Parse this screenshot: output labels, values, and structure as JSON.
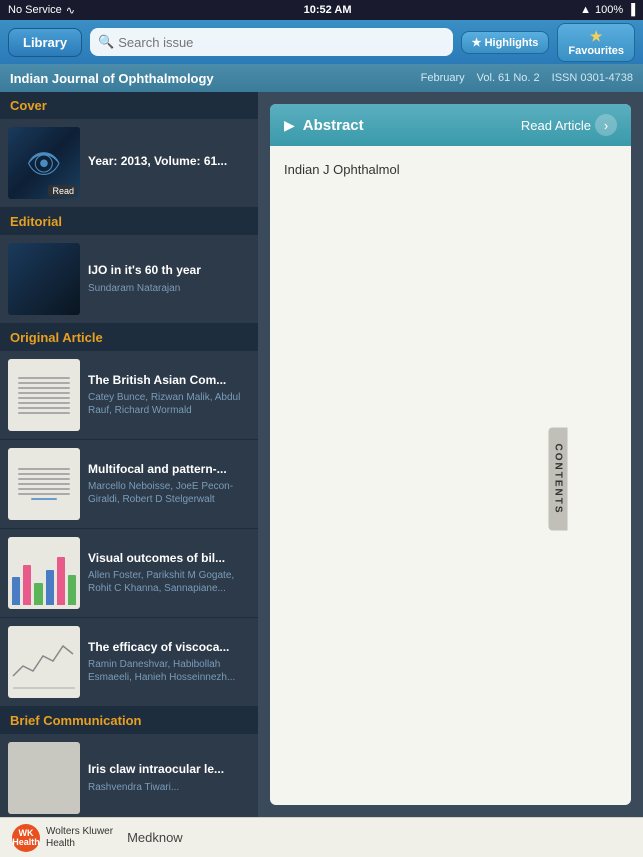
{
  "status_bar": {
    "carrier": "No Service",
    "time": "10:52 AM",
    "battery": "100%",
    "wifi": true,
    "location": true
  },
  "nav": {
    "library_label": "Library",
    "search_placeholder": "Search issue",
    "highlights_label": "Highlights",
    "favourites_label": "Favourites"
  },
  "journal_header": {
    "title": "Indian Journal of Ophthalmology",
    "month": "February",
    "volume": "Vol. 61 No. 2",
    "issn": "ISSN 0301-4738"
  },
  "sections": [
    {
      "name": "Cover",
      "articles": [
        {
          "title": "Year: 2013, Volume: 61...",
          "authors": "",
          "thumb_type": "cover",
          "has_read": true
        }
      ]
    },
    {
      "name": "Editorial",
      "articles": [
        {
          "title": "IJO in it's 60 th  year",
          "authors": "Sundaram Natarajan",
          "thumb_type": "editorial"
        }
      ]
    },
    {
      "name": "Original Article",
      "articles": [
        {
          "title": "The British Asian Com...",
          "authors": "Catey Bunce, Rizwan Malik, Abdul Rauf, Richard Wormald",
          "thumb_type": "document"
        },
        {
          "title": "Multifocal and pattern-...",
          "authors": "Marcello Neboisse, JoeE Pecon-Giraldi, Robert D Stelgerwalt",
          "thumb_type": "document2"
        },
        {
          "title": "Visual outcomes of bil...",
          "authors": "Allen Foster, Parikshit M Gogate, Rohit C Khanna, Sannapiane...",
          "thumb_type": "chart"
        },
        {
          "title": "The efficacy of viscoca...",
          "authors": "Ramin Daneshvar, Habibollah Esmaeeli, Hanieh Hosseinnezh...",
          "thumb_type": "graph"
        }
      ]
    },
    {
      "name": "Brief Communication",
      "articles": [
        {
          "title": "Iris claw intraocular le...",
          "authors": "Rashvendra Tiwari...",
          "thumb_type": "small"
        }
      ]
    }
  ],
  "abstract": {
    "title": "Abstract",
    "read_article_label": "Read Article",
    "body_text": "Indian J Ophthalmol"
  },
  "contents_tab": {
    "label": "CONTENTS"
  },
  "bottom_bar": {
    "wk_initials": "WK\nHealth",
    "company": "Wolters Kluwer",
    "subtitle": "Health",
    "medknow": "Medknow"
  }
}
